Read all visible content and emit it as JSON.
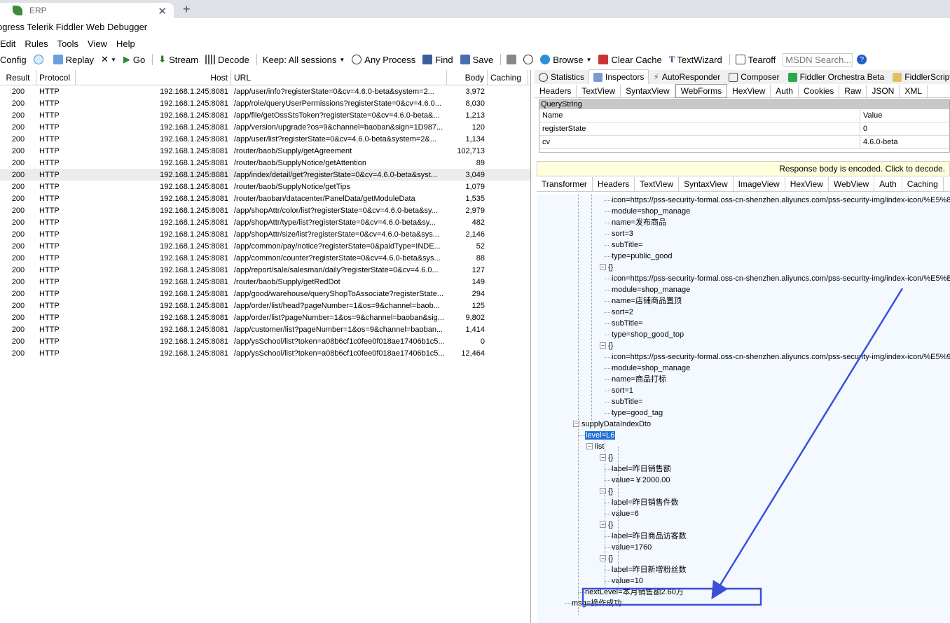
{
  "browser": {
    "tab_title": "ERP",
    "close": "✕",
    "new_tab": "+"
  },
  "window_title": "ogress Telerik Fiddler Web Debugger",
  "menu": [
    "Edit",
    "Rules",
    "Tools",
    "View",
    "Help"
  ],
  "toolbar": {
    "config": "Config",
    "replay": "Replay",
    "remove": "✕",
    "go": "Go",
    "stream": "Stream",
    "decode": "Decode",
    "keep": "Keep: All sessions",
    "any_process": "Any Process",
    "find": "Find",
    "save": "Save",
    "browse": "Browse",
    "clear_cache": "Clear Cache",
    "textwizard": "TextWizard",
    "tearoff": "Tearoff",
    "msdn_placeholder": "MSDN Search..."
  },
  "grid": {
    "headers": {
      "result": "Result",
      "protocol": "Protocol",
      "host": "Host",
      "url": "URL",
      "body": "Body",
      "caching": "Caching"
    },
    "rows": [
      {
        "result": "200",
        "protocol": "HTTP",
        "host": "192.168.1.245:8081",
        "url": "/app/user/info?registerState=0&cv=4.6.0-beta&system=2...",
        "body": "3,972"
      },
      {
        "result": "200",
        "protocol": "HTTP",
        "host": "192.168.1.245:8081",
        "url": "/app/role/queryUserPermissions?registerState=0&cv=4.6.0...",
        "body": "8,030"
      },
      {
        "result": "200",
        "protocol": "HTTP",
        "host": "192.168.1.245:8081",
        "url": "/app/file/getOssStsToken?registerState=0&cv=4.6.0-beta&...",
        "body": "1,213"
      },
      {
        "result": "200",
        "protocol": "HTTP",
        "host": "192.168.1.245:8081",
        "url": "/app/version/upgrade?os=9&channel=baoban&sign=1D987...",
        "body": "120"
      },
      {
        "result": "200",
        "protocol": "HTTP",
        "host": "192.168.1.245:8081",
        "url": "/app/user/list?registerState=0&cv=4.6.0-beta&system=2&...",
        "body": "1,134"
      },
      {
        "result": "200",
        "protocol": "HTTP",
        "host": "192.168.1.245:8081",
        "url": "/router/baob/Supply/getAgreement",
        "body": "102,713"
      },
      {
        "result": "200",
        "protocol": "HTTP",
        "host": "192.168.1.245:8081",
        "url": "/router/baob/SupplyNotice/getAttention",
        "body": "89"
      },
      {
        "result": "200",
        "protocol": "HTTP",
        "host": "192.168.1.245:8081",
        "url": "/app/index/detail/get?registerState=0&cv=4.6.0-beta&syst...",
        "body": "3,049",
        "selected": true
      },
      {
        "result": "200",
        "protocol": "HTTP",
        "host": "192.168.1.245:8081",
        "url": "/router/baob/SupplyNotice/getTips",
        "body": "1,079"
      },
      {
        "result": "200",
        "protocol": "HTTP",
        "host": "192.168.1.245:8081",
        "url": "/router/baoban/datacenter/PanelData/getModuleData",
        "body": "1,535"
      },
      {
        "result": "200",
        "protocol": "HTTP",
        "host": "192.168.1.245:8081",
        "url": "/app/shopAttr/color/list?registerState=0&cv=4.6.0-beta&sy...",
        "body": "2,979"
      },
      {
        "result": "200",
        "protocol": "HTTP",
        "host": "192.168.1.245:8081",
        "url": "/app/shopAttr/type/list?registerState=0&cv=4.6.0-beta&sy...",
        "body": "482"
      },
      {
        "result": "200",
        "protocol": "HTTP",
        "host": "192.168.1.245:8081",
        "url": "/app/shopAttr/size/list?registerState=0&cv=4.6.0-beta&sys...",
        "body": "2,146"
      },
      {
        "result": "200",
        "protocol": "HTTP",
        "host": "192.168.1.245:8081",
        "url": "/app/common/pay/notice?registerState=0&paidType=INDE...",
        "body": "52"
      },
      {
        "result": "200",
        "protocol": "HTTP",
        "host": "192.168.1.245:8081",
        "url": "/app/common/counter?registerState=0&cv=4.6.0-beta&sys...",
        "body": "88"
      },
      {
        "result": "200",
        "protocol": "HTTP",
        "host": "192.168.1.245:8081",
        "url": "/app/report/sale/salesman/daily?registerState=0&cv=4.6.0...",
        "body": "127"
      },
      {
        "result": "200",
        "protocol": "HTTP",
        "host": "192.168.1.245:8081",
        "url": "/router/baob/Supply/getRedDot",
        "body": "149"
      },
      {
        "result": "200",
        "protocol": "HTTP",
        "host": "192.168.1.245:8081",
        "url": "/app/good/warehouse/queryShopToAssociate?registerState...",
        "body": "294"
      },
      {
        "result": "200",
        "protocol": "HTTP",
        "host": "192.168.1.245:8081",
        "url": "/app/order/list/head?pageNumber=1&os=9&channel=baob...",
        "body": "125"
      },
      {
        "result": "200",
        "protocol": "HTTP",
        "host": "192.168.1.245:8081",
        "url": "/app/order/list?pageNumber=1&os=9&channel=baoban&sig...",
        "body": "9,802"
      },
      {
        "result": "200",
        "protocol": "HTTP",
        "host": "192.168.1.245:8081",
        "url": "/app/customer/list?pageNumber=1&os=9&channel=baoban...",
        "body": "1,414"
      },
      {
        "result": "200",
        "protocol": "HTTP",
        "host": "192.168.1.245:8081",
        "url": "/app/ysSchool/list?token=a08b6cf1c0fee0f018ae17406b1c5...",
        "body": "0"
      },
      {
        "result": "200",
        "protocol": "HTTP",
        "host": "192.168.1.245:8081",
        "url": "/app/ysSchool/list?token=a08b6cf1c0fee0f018ae17406b1c5...",
        "body": "12,464"
      }
    ]
  },
  "inspector_tabs": [
    "Statistics",
    "Inspectors",
    "AutoResponder",
    "Composer",
    "Fiddler Orchestra Beta",
    "FiddlerScript"
  ],
  "request_tabs": [
    "Headers",
    "TextView",
    "SyntaxView",
    "WebForms",
    "HexView",
    "Auth",
    "Cookies",
    "Raw",
    "JSON",
    "XML"
  ],
  "querystring": {
    "title": "QueryString",
    "col_name": "Name",
    "col_value": "Value",
    "rows": [
      {
        "name": "registerState",
        "value": "0"
      },
      {
        "name": "cv",
        "value": "4.6.0-beta"
      }
    ]
  },
  "response_notice": "Response body is encoded. Click to decode.",
  "response_tabs": [
    "Transformer",
    "Headers",
    "TextView",
    "SyntaxView",
    "ImageView",
    "HexView",
    "WebView",
    "Auth",
    "Caching"
  ],
  "tree": [
    "icon=https://pss-security-formal.oss-cn-shenzhen.aliyuncs.com/pss-security-img/index-icon/%E5%8",
    "module=shop_manage",
    "name=发布商品",
    "sort=3",
    "subTitle=",
    "type=public_good",
    "{}",
    "icon=https://pss-security-formal.oss-cn-shenzhen.aliyuncs.com/pss-security-img/index-icon/%E5%B",
    "module=shop_manage",
    "name=店铺商品置顶",
    "sort=2",
    "subTitle=",
    "type=shop_good_top",
    "{}",
    "icon=https://pss-security-formal.oss-cn-shenzhen.aliyuncs.com/pss-security-img/index-icon/%E5%9",
    "module=shop_manage",
    "name=商品打标",
    "sort=1",
    "subTitle=",
    "type=good_tag",
    "supplyDataIndexDto",
    "level=L6",
    "list",
    "{}",
    "label=昨日销售额",
    "value=￥2000.00",
    "{}",
    "label=昨日销售件数",
    "value=6",
    "{}",
    "label=昨日商品访客数",
    "value=1760",
    "{}",
    "label=昨日新增粉丝数",
    "value=10",
    "nextLevel=本月销售额2.60万",
    "msg=操作成功"
  ],
  "colors": {
    "annotation": "#3a4fd8",
    "selection": "#1e6fd9"
  }
}
